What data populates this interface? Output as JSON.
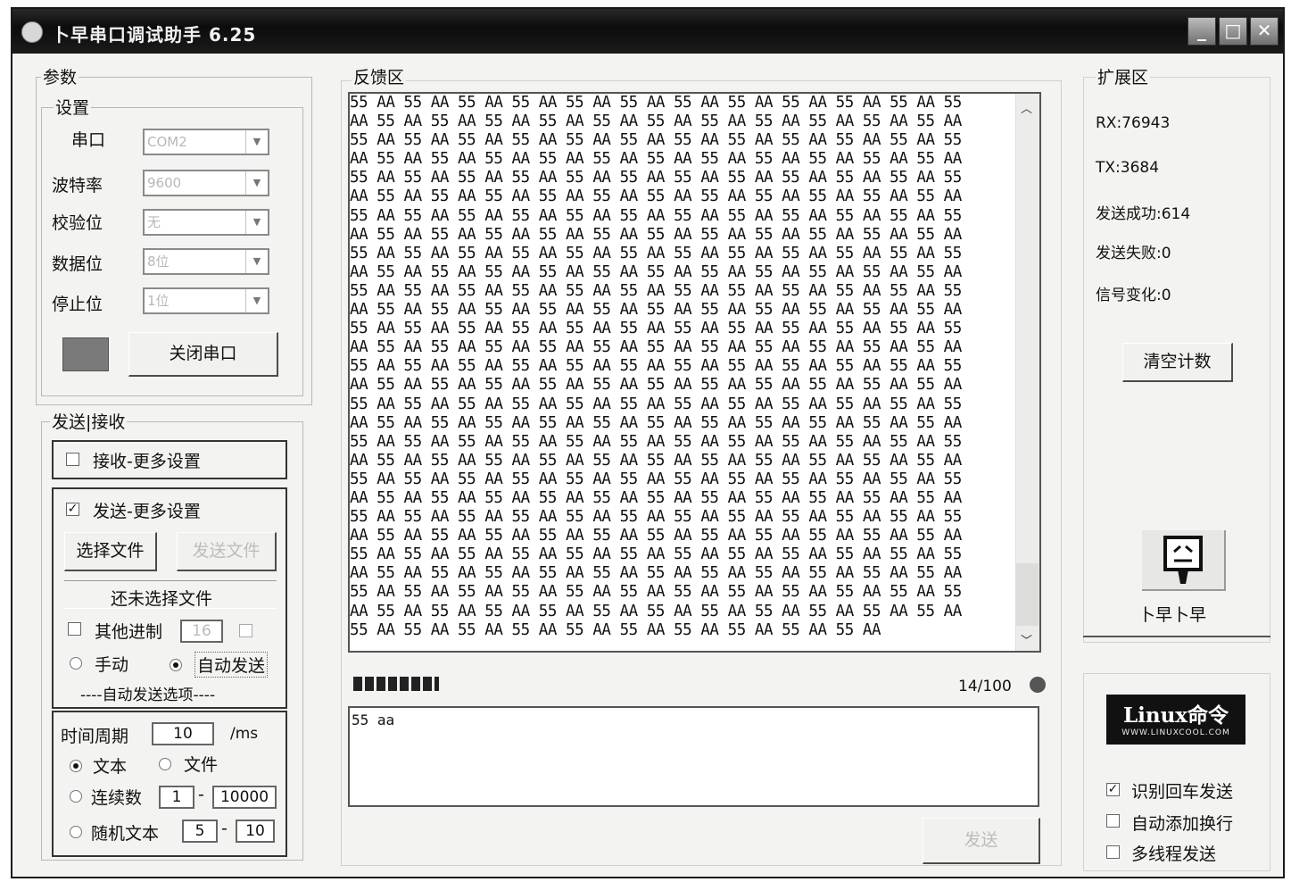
{
  "window": {
    "title": "卜早串口调试助手  6.25",
    "controls": {
      "minimize": "_",
      "maximize": "□",
      "close": "✕"
    }
  },
  "params": {
    "group_label": "参数",
    "settings_label": "设置",
    "port": {
      "label": "串口",
      "value": "COM2"
    },
    "baud": {
      "label": "波特率",
      "value": "9600"
    },
    "parity": {
      "label": "校验位",
      "value": "无"
    },
    "databits": {
      "label": "数据位",
      "value": "8位"
    },
    "stopbits": {
      "label": "停止位",
      "value": "1位"
    },
    "close_port_button": "关闭串口"
  },
  "send_recv": {
    "group_label": "发送|接收",
    "recv_more": {
      "label": "接收-更多设置",
      "checked": false
    },
    "send_more": {
      "label": "发送-更多设置",
      "checked": true
    },
    "select_file_button": "选择文件",
    "send_file_button": "发送文件",
    "file_status": "还未选择文件",
    "other_base": {
      "label": "其他进制",
      "value": "16"
    },
    "manual_label": "手动",
    "auto_send_label": "自动发送",
    "auto_options_label": "----自动发送选项----",
    "time_period": {
      "label": "时间周期",
      "value": "10",
      "unit": "/ms"
    },
    "text_label": "文本",
    "file_label": "文件",
    "sequence": {
      "label": "连续数",
      "from": "1",
      "to": "10000"
    },
    "random_text": {
      "label": "随机文本",
      "from": "5",
      "to": "10"
    },
    "dash": "-"
  },
  "feedback": {
    "label": "反馈区",
    "rows": 29,
    "pairs_per_row": 11,
    "last_row_pairs": 10,
    "tokens": [
      "55",
      "AA"
    ],
    "progress_text": "14/100",
    "send_text": "55 aa",
    "send_button": "发送"
  },
  "extension": {
    "label": "扩展区",
    "rx": "RX:76943",
    "tx": "TX:3684",
    "send_ok": "发送成功:614",
    "send_fail": "发送失败:0",
    "signal_change": "信号变化:0",
    "clear_button": "清空计数",
    "logo_caption": "卜早卜早",
    "linux_logo_main": "Linux命令",
    "linux_logo_sub": "WWW.LINUXCOOL.COM",
    "recog_enter": {
      "label": "识别回车发送",
      "checked": true
    },
    "auto_newline": {
      "label": "自动添加换行",
      "checked": false
    },
    "multithread": {
      "label": "多线程发送",
      "checked": false
    }
  },
  "icons": [
    "app-icon",
    "minimize-icon",
    "maximize-icon",
    "close-icon",
    "port-status-icon",
    "chevron-up-icon",
    "chevron-down-icon",
    "status-led-icon",
    "mascot-icon",
    "linux-logo"
  ]
}
